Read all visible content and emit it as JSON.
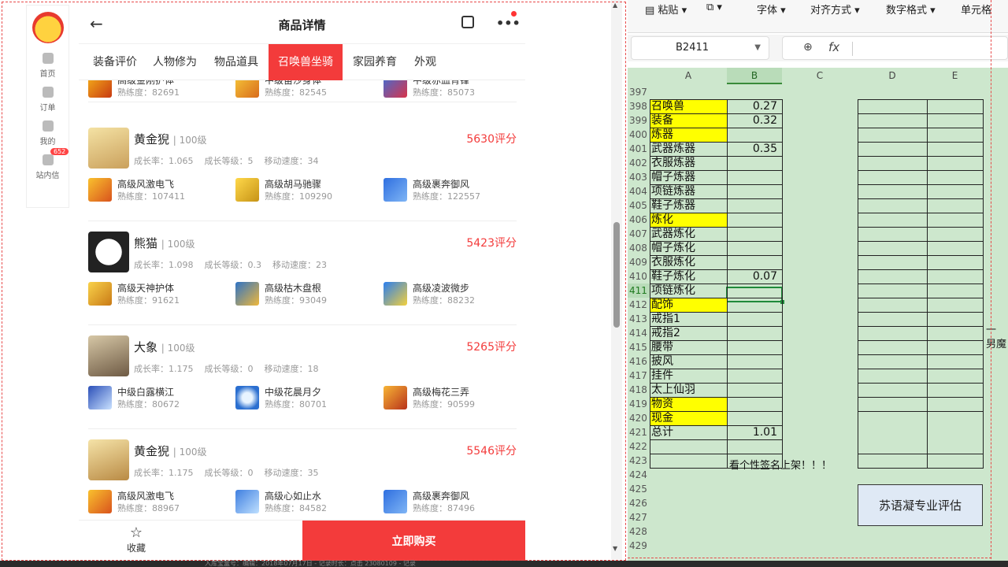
{
  "sidebar": {
    "items": [
      {
        "label": "首页"
      },
      {
        "label": "订单"
      },
      {
        "label": "我的"
      },
      {
        "label": "站内信",
        "badge": "652"
      }
    ]
  },
  "app": {
    "title": "商品详情",
    "tabs": [
      "装备评价",
      "人物修为",
      "物品道具",
      "召唤兽坐骑",
      "家园养育",
      "外观"
    ],
    "active_tab": "召唤兽坐骑",
    "partial_skills": [
      {
        "name": "高级金刚护体",
        "exp": "熟练度：82691"
      },
      {
        "name": "中级苗沙身体",
        "exp": "熟练度：82545"
      },
      {
        "name": "中级赤血背锋",
        "exp": "熟练度：85073"
      }
    ],
    "pets": [
      {
        "name": "黄金猊",
        "level": "| 100级",
        "score": "5630评分",
        "growth": "成长率：1.065",
        "grade": "成长等级：5",
        "speed": "移动速度：34",
        "skills": [
          {
            "name": "高级风激电飞",
            "exp": "熟练度：107411"
          },
          {
            "name": "高级胡马驰骤",
            "exp": "熟练度：109290"
          },
          {
            "name": "高级裹奔御风",
            "exp": "熟练度：122557"
          }
        ]
      },
      {
        "name": "熊猫",
        "level": "| 100级",
        "score": "5423评分",
        "growth": "成长率：1.098",
        "grade": "成长等级：0.3",
        "speed": "移动速度：23",
        "skills": [
          {
            "name": "高级天神护体",
            "exp": "熟练度：91621"
          },
          {
            "name": "高级枯木盘根",
            "exp": "熟练度：93049"
          },
          {
            "name": "高级凌波微步",
            "exp": "熟练度：88232"
          }
        ]
      },
      {
        "name": "大象",
        "level": "| 100级",
        "score": "5265评分",
        "growth": "成长率：1.175",
        "grade": "成长等级：0",
        "speed": "移动速度：18",
        "skills": [
          {
            "name": "中级白露横江",
            "exp": "熟练度：80672"
          },
          {
            "name": "中级花晨月夕",
            "exp": "熟练度：80701"
          },
          {
            "name": "高级梅花三弄",
            "exp": "熟练度：90599"
          }
        ]
      },
      {
        "name": "黄金猊",
        "level": "| 100级",
        "score": "5546评分",
        "growth": "成长率：1.175",
        "grade": "成长等级：0",
        "speed": "移动速度：35",
        "skills": [
          {
            "name": "高级风激电飞",
            "exp": "熟练度：88967"
          },
          {
            "name": "高级心如止水",
            "exp": "熟练度：84582"
          },
          {
            "name": "高级裹奔御风",
            "exp": "熟练度：87496"
          }
        ]
      }
    ],
    "favorite_label": "收藏",
    "buy_label": "立即购买"
  },
  "spreadsheet": {
    "ribbon": [
      "粘贴",
      "字体",
      "对齐方式",
      "数字格式",
      "单元格"
    ],
    "name_box": "B2411",
    "fx": "fx",
    "columns": [
      "A",
      "B",
      "C",
      "D",
      "E"
    ],
    "rows": [
      {
        "n": "397",
        "a": "",
        "b": "",
        "yellow": false
      },
      {
        "n": "398",
        "a": "召唤兽",
        "b": "0.27",
        "yellow": true
      },
      {
        "n": "399",
        "a": "装备",
        "b": "0.32",
        "yellow": true
      },
      {
        "n": "400",
        "a": "炼器",
        "b": "",
        "yellow": true
      },
      {
        "n": "401",
        "a": "武器炼器",
        "b": "0.35",
        "yellow": false
      },
      {
        "n": "402",
        "a": "衣服炼器",
        "b": "",
        "yellow": false
      },
      {
        "n": "403",
        "a": "帽子炼器",
        "b": "",
        "yellow": false
      },
      {
        "n": "404",
        "a": "项链炼器",
        "b": "",
        "yellow": false
      },
      {
        "n": "405",
        "a": "鞋子炼器",
        "b": "",
        "yellow": false
      },
      {
        "n": "406",
        "a": "炼化",
        "b": "",
        "yellow": true
      },
      {
        "n": "407",
        "a": "武器炼化",
        "b": "",
        "yellow": false
      },
      {
        "n": "408",
        "a": "帽子炼化",
        "b": "",
        "yellow": false
      },
      {
        "n": "409",
        "a": "衣服炼化",
        "b": "",
        "yellow": false
      },
      {
        "n": "410",
        "a": "鞋子炼化",
        "b": "0.07",
        "yellow": false
      },
      {
        "n": "411",
        "a": "项链炼化",
        "b": "",
        "yellow": false
      },
      {
        "n": "412",
        "a": "配饰",
        "b": "",
        "yellow": true
      },
      {
        "n": "413",
        "a": "戒指1",
        "b": "",
        "yellow": false
      },
      {
        "n": "414",
        "a": "戒指2",
        "b": "",
        "yellow": false
      },
      {
        "n": "415",
        "a": "腰带",
        "b": "",
        "yellow": false
      },
      {
        "n": "416",
        "a": "披风",
        "b": "",
        "yellow": false
      },
      {
        "n": "417",
        "a": "挂件",
        "b": "",
        "yellow": false
      },
      {
        "n": "418",
        "a": "太上仙羽",
        "b": "",
        "yellow": false
      },
      {
        "n": "419",
        "a": "物资",
        "b": "",
        "yellow": true
      },
      {
        "n": "420",
        "a": "现金",
        "b": "",
        "yellow": true
      },
      {
        "n": "421",
        "a": "总计",
        "b": "1.01",
        "yellow": false
      },
      {
        "n": "422",
        "a": "",
        "b": "",
        "yellow": false
      },
      {
        "n": "423",
        "a": "",
        "b": "",
        "yellow": false
      },
      {
        "n": "424",
        "a": "",
        "b": "",
        "yellow": false
      },
      {
        "n": "425",
        "a": "",
        "b": "",
        "yellow": false
      },
      {
        "n": "426",
        "a": "",
        "b": "",
        "yellow": false
      },
      {
        "n": "427",
        "a": "",
        "b": "",
        "yellow": false
      },
      {
        "n": "428",
        "a": "",
        "b": "",
        "yellow": false
      },
      {
        "n": "429",
        "a": "",
        "b": "",
        "yellow": false
      }
    ],
    "note_cell": "看个性签名上架！！！",
    "eval_box": "苏语凝专业评估",
    "edge_text_1": "一",
    "edge_text_2": "男魔",
    "selected_row": "411",
    "selected_col": "B"
  },
  "taskbar_text": "入库宝盒号：编辑：2018年07月17日 - 记录时长：点击 23080109 - 记录"
}
